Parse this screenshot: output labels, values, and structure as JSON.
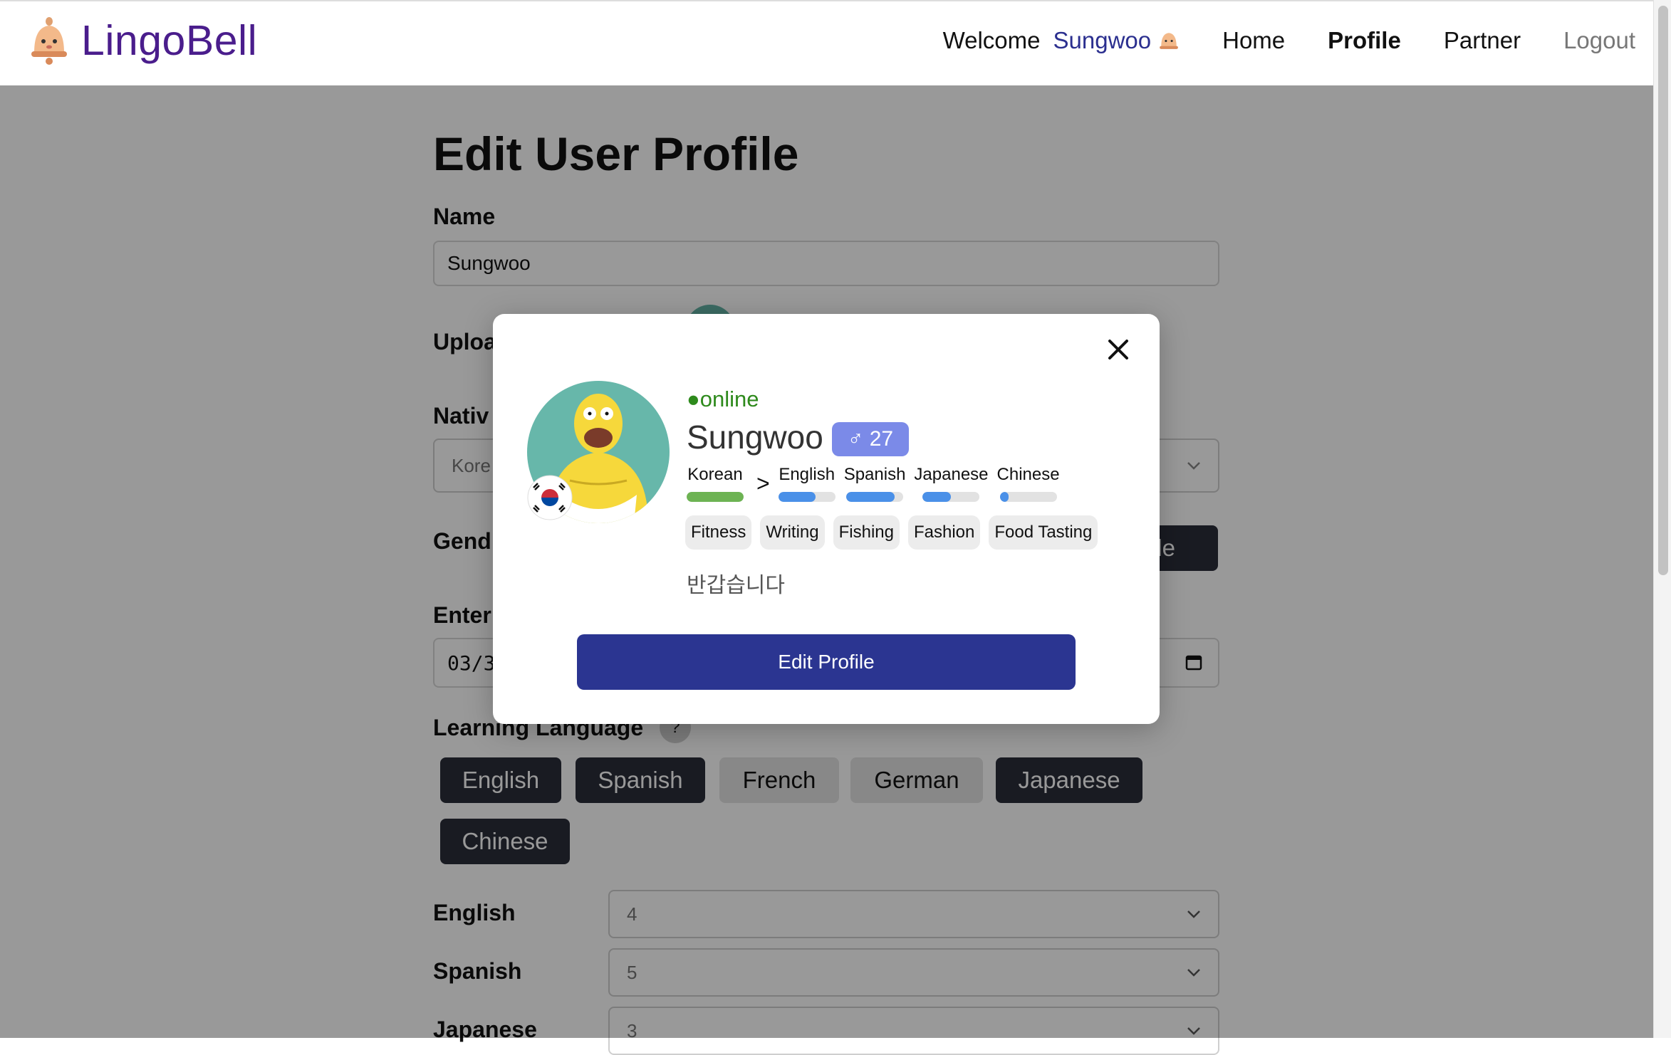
{
  "nav": {
    "brand": "LingoBell",
    "welcome": "Welcome",
    "user": "Sungwoo",
    "links": [
      "Home",
      "Profile",
      "Partner",
      "Logout"
    ],
    "active": "Profile"
  },
  "page": {
    "title": "Edit User Profile",
    "name_label": "Name",
    "name_value": "Sungwoo",
    "upload_label": "Uploa",
    "native_label": "Nativ",
    "native_value": "Kore",
    "gender_label": "Gend",
    "gender_selected_fragment": "ale",
    "birthday_label": "Enter",
    "birthday_fragment": "03/3",
    "learning_label": "Learning Language",
    "help_mark": "?",
    "learning_options": [
      {
        "label": "English",
        "selected": true
      },
      {
        "label": "Spanish",
        "selected": true
      },
      {
        "label": "French",
        "selected": false
      },
      {
        "label": "German",
        "selected": false
      },
      {
        "label": "Japanese",
        "selected": true
      },
      {
        "label": "Chinese",
        "selected": true
      }
    ],
    "levels": [
      {
        "label": "English",
        "value": "4"
      },
      {
        "label": "Spanish",
        "value": "5"
      },
      {
        "label": "Japanese",
        "value": "3"
      }
    ]
  },
  "modal": {
    "status": "●online",
    "name": "Sungwoo",
    "age_badge": "♂ 27",
    "native_language": {
      "name": "Korean",
      "level": 1.0,
      "color": "#6db353"
    },
    "arrow": ">",
    "learning": [
      {
        "name": "English",
        "level": 0.65,
        "color": "#4a90e8"
      },
      {
        "name": "Spanish",
        "level": 0.85,
        "color": "#4a90e8"
      },
      {
        "name": "Japanese",
        "level": 0.5,
        "color": "#4a90e8"
      },
      {
        "name": "Chinese",
        "level": 0.15,
        "color": "#4a90e8"
      }
    ],
    "interests": [
      "Fitness",
      "Writing",
      "Fishing",
      "Fashion",
      "Food Tasting"
    ],
    "bio": "반갑습니다",
    "edit_button": "Edit Profile"
  }
}
